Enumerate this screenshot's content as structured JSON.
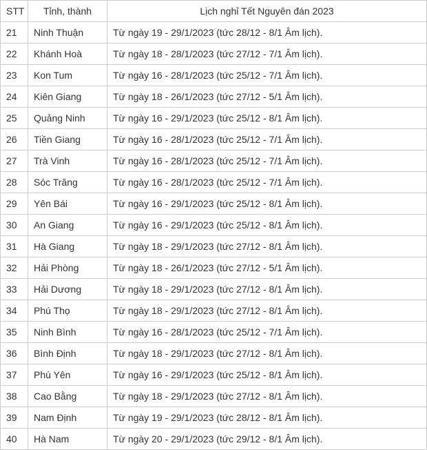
{
  "headers": {
    "stt": "STT",
    "province": "Tỉnh, thành",
    "schedule": "Lịch nghỉ Tết Nguyên đán 2023"
  },
  "rows": [
    {
      "stt": "21",
      "province": "Ninh Thuận",
      "schedule": "Từ ngày 19 - 29/1/2023 (tức 28/12 - 8/1 Âm lịch)."
    },
    {
      "stt": "22",
      "province": "Khánh Hoà",
      "schedule": "Từ ngày 18 - 28/1/2023 (tức 27/12 - 7/1 Âm lịch)."
    },
    {
      "stt": "23",
      "province": "Kon Tum",
      "schedule": "Từ ngày 16 - 28/1/2023 (tức 25/12 - 7/1 Âm lịch)."
    },
    {
      "stt": "24",
      "province": "Kiên Giang",
      "schedule": "Từ ngày 18 - 26/1/2023 (tức 27/12 - 5/1 Âm lịch)."
    },
    {
      "stt": "25",
      "province": "Quảng Ninh",
      "schedule": "Từ ngày 16 - 29/1/2023 (tức 25/12 - 8/1 Âm lịch)."
    },
    {
      "stt": "26",
      "province": "Tiền Giang",
      "schedule": "Từ ngày 16 - 28/1/2023 (tức 25/12 - 7/1 Âm lịch)."
    },
    {
      "stt": "27",
      "province": "Trà Vinh",
      "schedule": "Từ ngày 16 - 28/1/2023 (tức 25/12 - 7/1 Âm lịch)."
    },
    {
      "stt": "28",
      "province": "Sóc Trăng",
      "schedule": "Từ ngày 16 - 28/1/2023 (tức 25/12 - 7/1 Âm lịch)."
    },
    {
      "stt": "29",
      "province": "Yên Bái",
      "schedule": "Từ ngày 16 - 29/1/2023 (tức 25/12 - 8/1 Âm lịch)."
    },
    {
      "stt": "30",
      "province": "An Giang",
      "schedule": "Từ ngày 16 - 29/1/2023 (tức 25/12 - 8/1 Âm lịch)."
    },
    {
      "stt": "31",
      "province": "Hà Giang",
      "schedule": "Từ ngày 18 - 29/1/2023 (tức 27/12 - 8/1 Âm lịch)."
    },
    {
      "stt": "32",
      "province": "Hải Phòng",
      "schedule": "Từ ngày 18 - 26/1/2023 (tức 27/12 - 5/1 Âm lịch)."
    },
    {
      "stt": "33",
      "province": "Hải Dương",
      "schedule": "Từ ngày 18 - 29/1/2023 (tức 27/12 - 8/1 Âm lịch)."
    },
    {
      "stt": "34",
      "province": "Phú Thọ",
      "schedule": "Từ ngày 18 - 29/1/2023 (tức 27/12 - 8/1 Âm lịch)."
    },
    {
      "stt": "35",
      "province": "Ninh Bình",
      "schedule": "Từ ngày 16 - 28/1/2023 (tức 25/12 - 7/1 Âm lịch)."
    },
    {
      "stt": "36",
      "province": "Bình Định",
      "schedule": "Từ ngày 18 - 29/1/2023 (tức 27/12 - 8/1 Âm lịch)."
    },
    {
      "stt": "37",
      "province": "Phú Yên",
      "schedule": "Từ ngày 16 - 29/1/2023 (tức 25/12 - 8/1 Âm lịch)."
    },
    {
      "stt": "38",
      "province": "Cao Bằng",
      "schedule": "Từ ngày 18 - 29/1/2023 (tức 27/12 - 8/1 Âm lịch)."
    },
    {
      "stt": "39",
      "province": "Nam Định",
      "schedule": "Từ ngày 19 - 29/1/2023 (tức 28/12 - 8/1 Âm lịch)."
    },
    {
      "stt": "40",
      "province": "Hà Nam",
      "schedule": "Từ ngày 20 - 29/1/2023 (tức 29/12 - 8/1 Âm lịch)."
    }
  ]
}
